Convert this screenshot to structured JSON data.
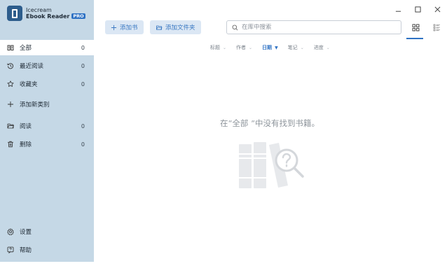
{
  "app": {
    "name_line1": "Icecream",
    "name_line2": "Ebook Reader",
    "badge": "PRO"
  },
  "sidebar": {
    "items": [
      {
        "label": "全部",
        "count": "0",
        "icon": "book-open-icon"
      },
      {
        "label": "最近阅读",
        "count": "0",
        "icon": "history-icon"
      },
      {
        "label": "收藏夹",
        "count": "0",
        "icon": "star-icon"
      },
      {
        "label": "添加新类别",
        "icon": "plus-icon"
      },
      {
        "label": "阅读",
        "count": "0",
        "icon": "folder-open-icon"
      },
      {
        "label": "删除",
        "count": "0",
        "icon": "trash-icon"
      }
    ],
    "settings_label": "设置",
    "help_label": "帮助"
  },
  "toolbar": {
    "add_book_label": "添加书",
    "add_folder_label": "添加文件夹"
  },
  "search": {
    "placeholder": "在库中搜索"
  },
  "sort": {
    "items": [
      {
        "label": "标题"
      },
      {
        "label": "作者"
      },
      {
        "label": "日期",
        "active": true
      },
      {
        "label": "笔记"
      },
      {
        "label": "进度"
      }
    ]
  },
  "empty": {
    "message": "在“全部 ”中没有找到书籍。"
  },
  "colors": {
    "sidebar_bg": "#c5d8e6",
    "accent": "#2f72c4",
    "button_bg": "#dbe7f4"
  }
}
